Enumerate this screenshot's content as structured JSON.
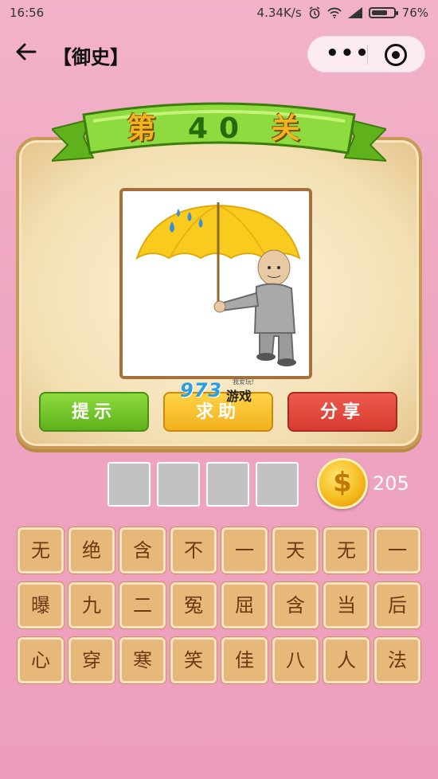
{
  "status_bar": {
    "time": "16:56",
    "network_speed": "4.34K/s",
    "battery": "76%",
    "battery_level": 0.76
  },
  "nav": {
    "title": "【御史】"
  },
  "level": {
    "prefix": "第",
    "number": "40",
    "suffix": "关"
  },
  "actions": {
    "hint": "提示",
    "help": "求助",
    "share": "分享"
  },
  "watermark": {
    "number": "973",
    "text": "游戏",
    "small": "我爱玩!"
  },
  "answer": {
    "slots": [
      "",
      "",
      "",
      ""
    ]
  },
  "coins": {
    "count": "205"
  },
  "tiles": {
    "row1": [
      "无",
      "绝",
      "含",
      "不",
      "一",
      "天",
      "无",
      "一"
    ],
    "row2": [
      "曝",
      "九",
      "二",
      "冤",
      "屈",
      "含",
      "当",
      "后"
    ],
    "row3": [
      "心",
      "穿",
      "寒",
      "笑",
      "佳",
      "八",
      "人",
      "法"
    ]
  },
  "colors": {
    "hint": "#6cc327",
    "help": "#f5bb26",
    "share": "#df4437",
    "background": "#efa6c2"
  },
  "icons": [
    "back-arrow-icon",
    "more-dots-icon",
    "close-target-icon",
    "alarm-icon",
    "wifi-icon",
    "signal-icon",
    "battery-icon",
    "coin-icon"
  ]
}
